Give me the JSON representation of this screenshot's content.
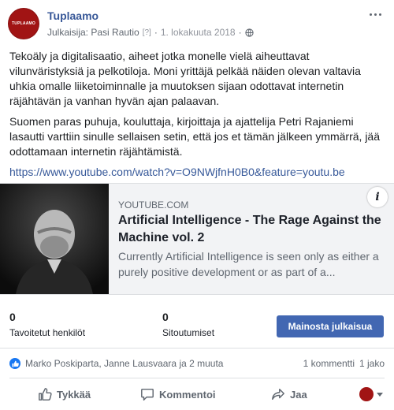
{
  "post": {
    "page_name": "Tuplaamo",
    "avatar_text": "TUPLAAMO",
    "publisher": "Julkaisija: Pasi Rautio",
    "help_mark": "[?]",
    "date": "1. lokakuuta 2018",
    "separator": "·",
    "paragraph1": "Tekoäly ja digitalisaatio, aiheet jotka monelle vielä aiheuttavat vilunväristyksiä ja pelkotiloja. Moni yrittäjä pelkää näiden olevan valtavia uhkia omalle liiketoiminnalle ja muutoksen sijaan odottavat internetin räjähtävän ja vanhan hyvän ajan palaavan.",
    "paragraph2": "Suomen paras puhuja, kouluttaja, kirjoittaja ja ajattelija Petri Rajaniemi lasautti varttiin sinulle sellaisen setin, että jos et tämän jälkeen ymmärrä, jää odottamaan internetin räjähtämistä.",
    "link": "https://www.youtube.com/watch?v=O9NWjfnH0B0&feature=youtu.be"
  },
  "preview": {
    "domain": "YOUTUBE.COM",
    "title": "Artificial Intelligence - The Rage Against the Machine vol. 2",
    "description": "Currently Artificial Intelligence is seen only as either a purely positive development or as part of a...",
    "info_label": "i"
  },
  "stats": {
    "reached_count": "0",
    "reached_label": "Tavoitetut henkilöt",
    "engagement_count": "0",
    "engagement_label": "Sitoutumiset",
    "promote_label": "Mainosta julkaisua"
  },
  "reactions": {
    "names": "Marko Poskiparta, Janne Lausvaara ja 2 muuta",
    "comments": "1 kommentti",
    "shares": "1 jako"
  },
  "actions": {
    "like": "Tykkää",
    "comment": "Kommentoi",
    "share": "Jaa"
  },
  "icons": {
    "globe": "globe-icon",
    "more": "more-options-icon",
    "like_badge": "thumbs-up-icon",
    "like": "thumbs-up-outline-icon",
    "comment": "comment-bubble-icon",
    "share": "share-arrow-icon",
    "dropdown": "caret-down-icon"
  },
  "colors": {
    "link": "#365899",
    "page_name": "#385898",
    "promote_button": "#4267b2",
    "like_badge": "#1877f2",
    "avatar": "#a11414"
  }
}
